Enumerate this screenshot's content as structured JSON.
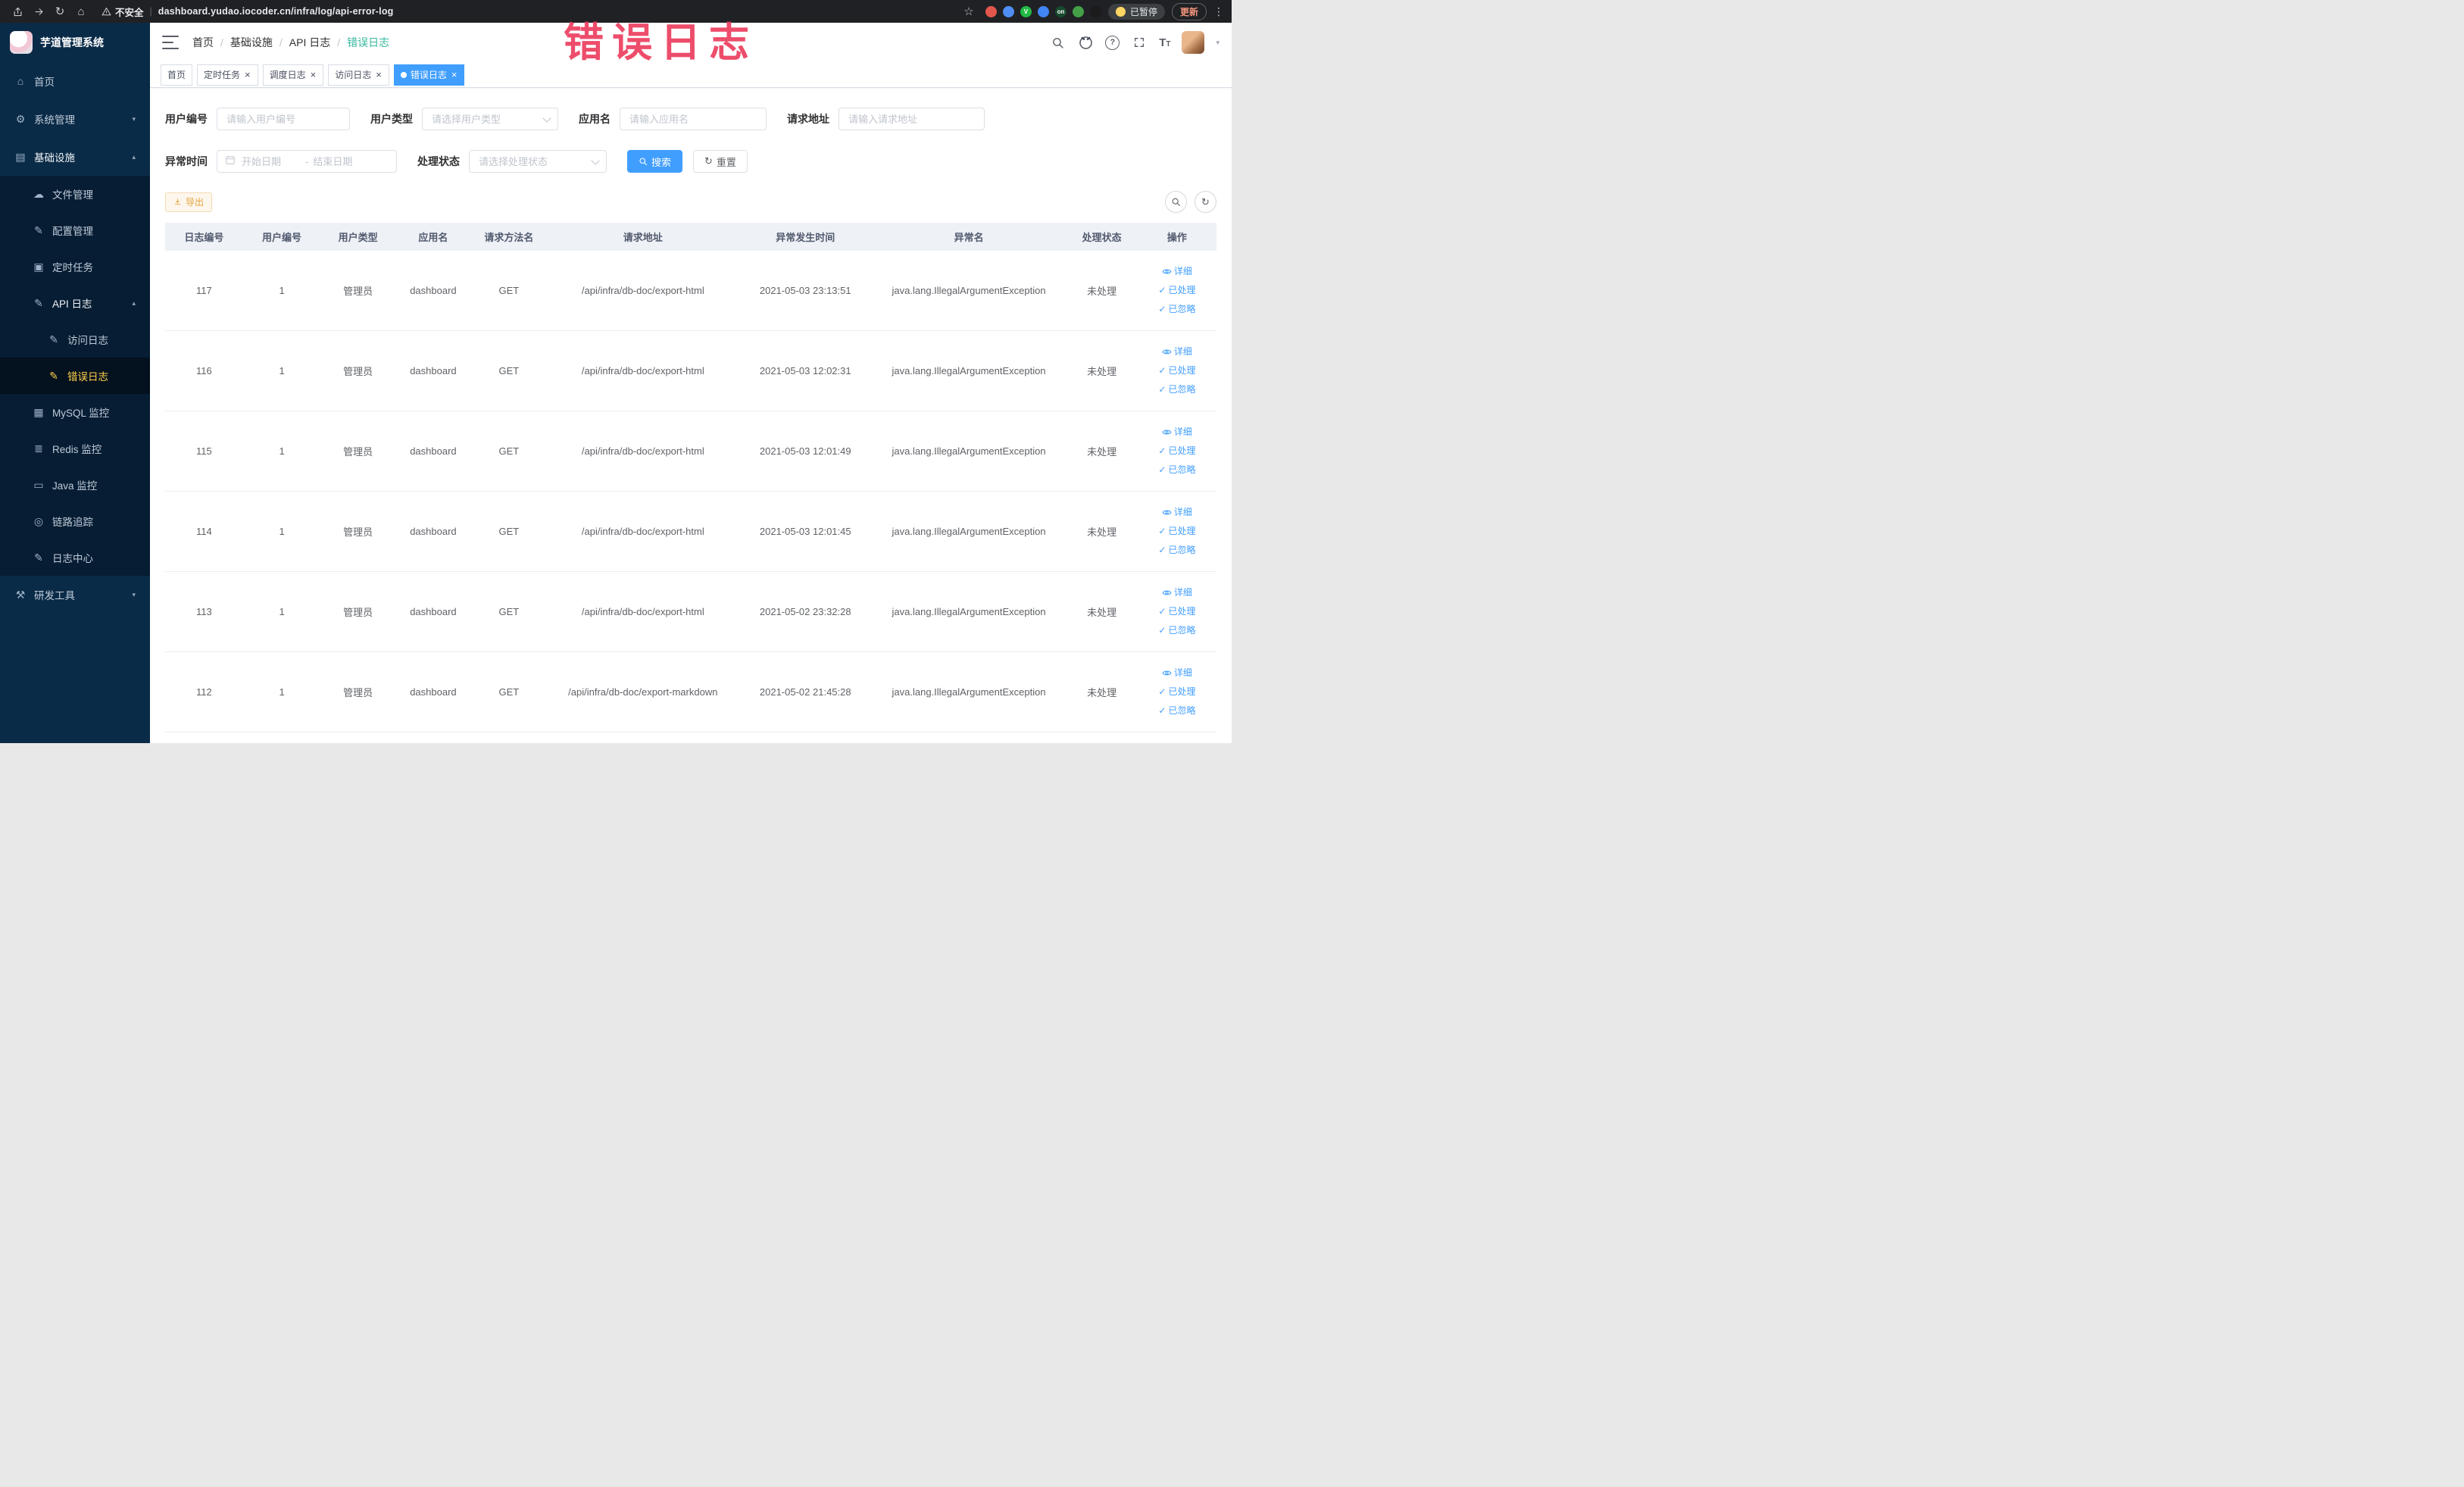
{
  "browser": {
    "security_label": "不安全",
    "url": "dashboard.yudao.iocoder.cn/infra/log/api-error-log",
    "paused_badge": "已暂停",
    "update_button": "更新",
    "extensions": [
      {
        "color": "#e2574c",
        "label": ""
      },
      {
        "color": "#4f8df5",
        "label": ""
      },
      {
        "color": "#21ba45",
        "label": "V"
      },
      {
        "color": "#4285f4",
        "label": ""
      },
      {
        "color": "#17492e",
        "label": "on"
      },
      {
        "color": "#43a047",
        "label": ""
      },
      {
        "color": "#1b1b1b",
        "label": ""
      }
    ]
  },
  "overlay": {
    "annotation": "错误日志"
  },
  "sidebar": {
    "logo_title": "芋道管理系统",
    "items": [
      {
        "label": "首页",
        "icon": "home-icon",
        "level": 1
      },
      {
        "label": "系统管理",
        "icon": "gear-icon",
        "level": 1,
        "arrow": "down"
      },
      {
        "label": "基础设施",
        "icon": "infra-icon",
        "level": 1,
        "arrow": "up",
        "open": true
      },
      {
        "label": "文件管理",
        "icon": "folder-icon",
        "level": 2
      },
      {
        "label": "配置管理",
        "icon": "config-icon",
        "level": 2
      },
      {
        "label": "定时任务",
        "icon": "task-icon",
        "level": 2
      },
      {
        "label": "API 日志",
        "icon": "log-icon",
        "level": 2,
        "arrow": "up",
        "open": true
      },
      {
        "label": "访问日志",
        "icon": "log-icon",
        "level": 3
      },
      {
        "label": "错误日志",
        "icon": "log-icon",
        "level": 3,
        "active": true
      },
      {
        "label": "MySQL 监控",
        "icon": "db-icon",
        "level": 2
      },
      {
        "label": "Redis 监控",
        "icon": "redis-icon",
        "level": 2
      },
      {
        "label": "Java 监控",
        "icon": "java-icon",
        "level": 2
      },
      {
        "label": "链路追踪",
        "icon": "trace-icon",
        "level": 2
      },
      {
        "label": "日志中心",
        "icon": "log-icon",
        "level": 2
      },
      {
        "label": "研发工具",
        "icon": "tools-icon",
        "level": 1,
        "arrow": "down"
      }
    ]
  },
  "header": {
    "breadcrumb": [
      "首页",
      "基础设施",
      "API 日志",
      "错误日志"
    ]
  },
  "tabs": [
    {
      "label": "首页",
      "closable": false,
      "active": false
    },
    {
      "label": "定时任务",
      "closable": true,
      "active": false
    },
    {
      "label": "调度日志",
      "closable": true,
      "active": false
    },
    {
      "label": "访问日志",
      "closable": true,
      "active": false
    },
    {
      "label": "错误日志",
      "closable": true,
      "active": true
    }
  ],
  "filters": {
    "user_id_label": "用户编号",
    "user_id_placeholder": "请输入用户编号",
    "user_type_label": "用户类型",
    "user_type_placeholder": "请选择用户类型",
    "app_name_label": "应用名",
    "app_name_placeholder": "请输入应用名",
    "request_url_label": "请求地址",
    "request_url_placeholder": "请输入请求地址",
    "exception_time_label": "异常时间",
    "date_start_placeholder": "开始日期",
    "date_separator": "-",
    "date_end_placeholder": "结束日期",
    "process_status_label": "处理状态",
    "process_status_placeholder": "请选择处理状态",
    "search_button": "搜索",
    "reset_button": "重置"
  },
  "toolbar": {
    "export_button": "导出"
  },
  "table": {
    "columns": [
      "日志编号",
      "用户编号",
      "用户类型",
      "应用名",
      "请求方法名",
      "请求地址",
      "异常发生时间",
      "异常名",
      "处理状态",
      "操作"
    ],
    "actions": [
      "详细",
      "已处理",
      "已忽略"
    ],
    "rows": [
      {
        "cells": [
          "117",
          "1",
          "管理员",
          "dashboard",
          "GET",
          "/api/infra/db-doc/export-html",
          "2021-05-03 23:13:51",
          "java.lang.IllegalArgumentException",
          "未处理"
        ]
      },
      {
        "cells": [
          "116",
          "1",
          "管理员",
          "dashboard",
          "GET",
          "/api/infra/db-doc/export-html",
          "2021-05-03 12:02:31",
          "java.lang.IllegalArgumentException",
          "未处理"
        ]
      },
      {
        "cells": [
          "115",
          "1",
          "管理员",
          "dashboard",
          "GET",
          "/api/infra/db-doc/export-html",
          "2021-05-03 12:01:49",
          "java.lang.IllegalArgumentException",
          "未处理"
        ]
      },
      {
        "cells": [
          "114",
          "1",
          "管理员",
          "dashboard",
          "GET",
          "/api/infra/db-doc/export-html",
          "2021-05-03 12:01:45",
          "java.lang.IllegalArgumentException",
          "未处理"
        ]
      },
      {
        "cells": [
          "113",
          "1",
          "管理员",
          "dashboard",
          "GET",
          "/api/infra/db-doc/export-html",
          "2021-05-02 23:32:28",
          "java.lang.IllegalArgumentException",
          "未处理"
        ]
      },
      {
        "cells": [
          "112",
          "1",
          "管理员",
          "dashboard",
          "GET",
          "/api/infra/db-doc/export-markdown",
          "2021-05-02 21:45:28",
          "java.lang.IllegalArgumentException",
          "未处理"
        ]
      }
    ]
  },
  "colors": {
    "accent": "#409eff",
    "menu_active": "#ffd04b",
    "breadcrumb_active": "#35b79e",
    "warning": "#e6a23c",
    "annotation": "#ec3e5e",
    "sidebar_bg": "#0a2b47",
    "submenu_bg": "#061d33"
  }
}
